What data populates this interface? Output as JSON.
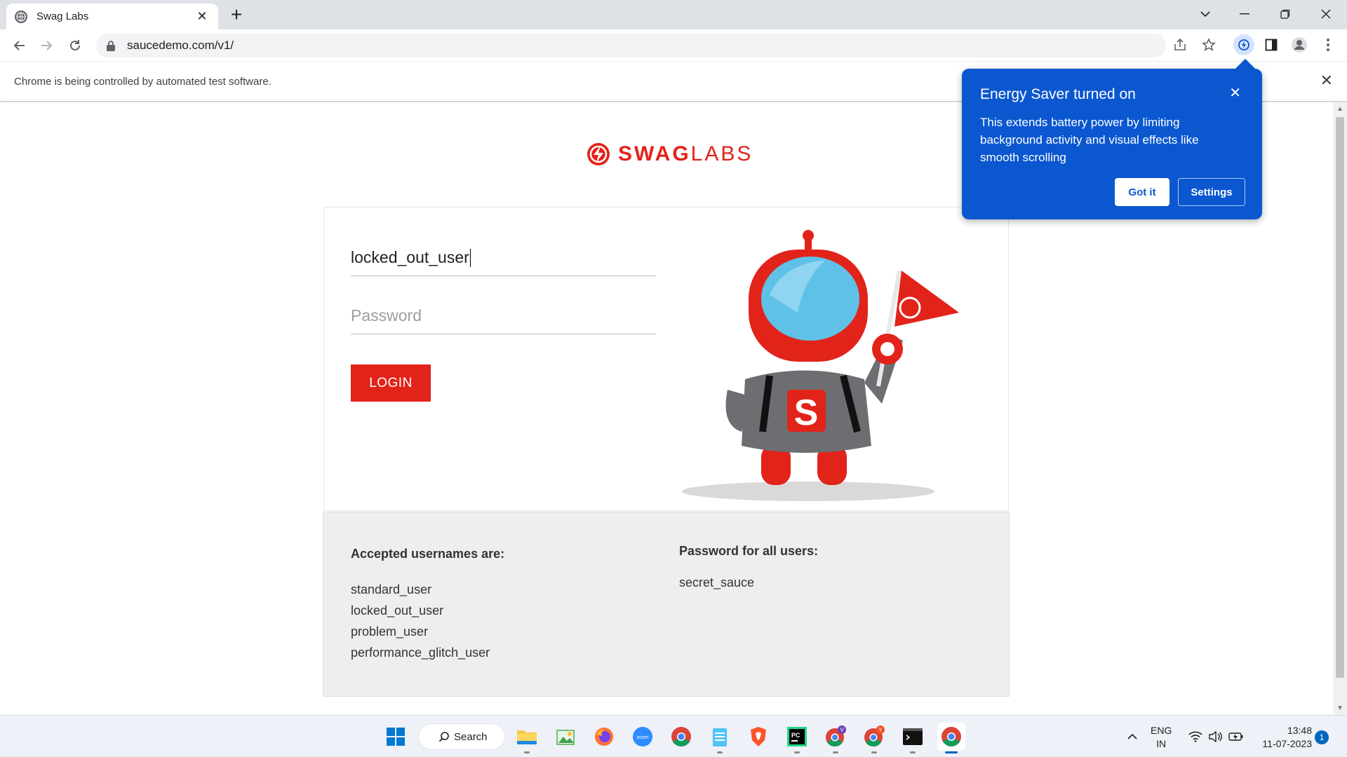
{
  "browser": {
    "tab_title": "Swag Labs",
    "url": "saucedemo.com/v1/",
    "infobar_message": "Chrome is being controlled by automated test software."
  },
  "energy_saver": {
    "title": "Energy Saver turned on",
    "body": "This extends battery power by limiting background activity and visual effects like smooth scrolling",
    "got_it": "Got it",
    "settings": "Settings"
  },
  "page": {
    "logo_bold": "SWAG",
    "logo_light": "LABS",
    "username_value": "locked_out_user",
    "password_placeholder": "Password",
    "login_button": "LOGIN",
    "usernames_heading": "Accepted usernames are:",
    "usernames": [
      "standard_user",
      "locked_out_user",
      "problem_user",
      "performance_glitch_user"
    ],
    "password_heading": "Password for all users:",
    "password_value": "secret_sauce"
  },
  "taskbar": {
    "search_label": "Search",
    "lang_line1": "ENG",
    "lang_line2": "IN",
    "time": "13:48",
    "date": "11-07-2023",
    "notification_count": "1"
  },
  "colors": {
    "brand_red": "#e2231a",
    "bubble_blue": "#0b57d0"
  }
}
